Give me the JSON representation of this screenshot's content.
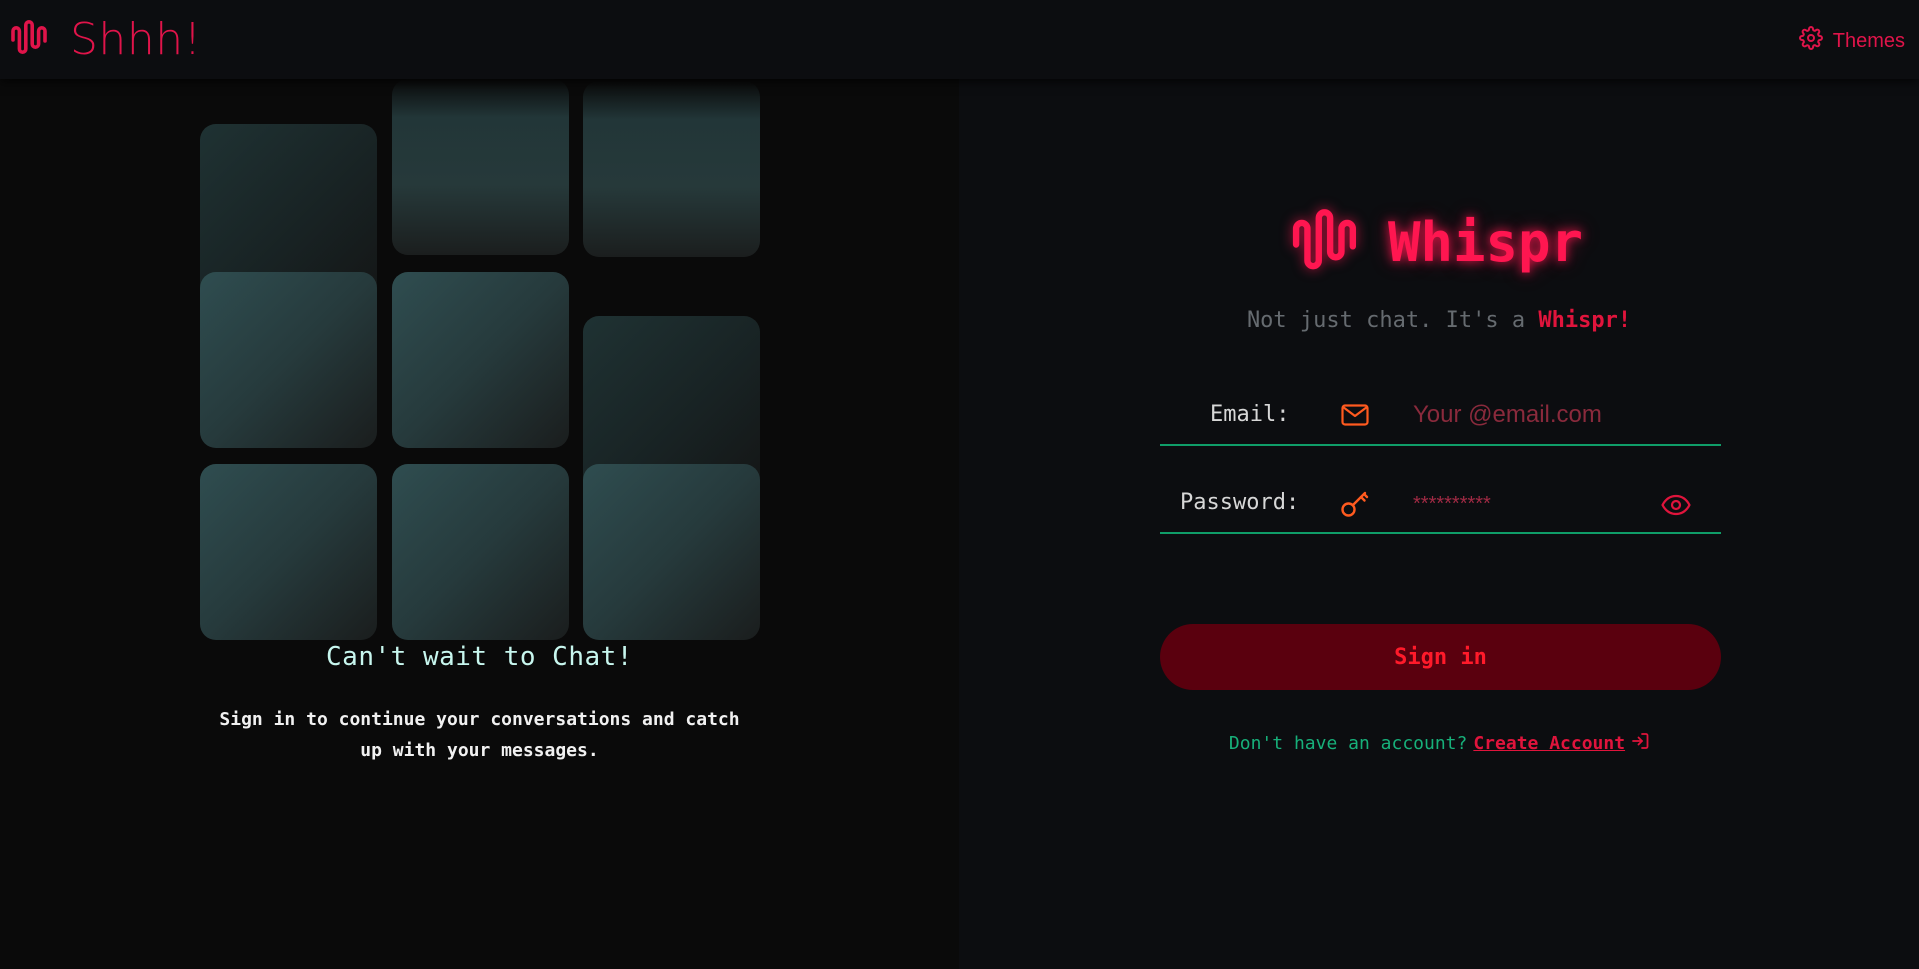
{
  "navbar": {
    "brand": "Shhh!",
    "themes_label": "Themes",
    "icons": {
      "logo": "sound-wave-icon",
      "themes": "gear-icon"
    }
  },
  "left": {
    "heading": "Can't wait to Chat!",
    "description": "Sign in to continue your conversations and catch up with your messages."
  },
  "auth": {
    "brand": "Whispr",
    "tagline_prefix": "Not just chat. It's a ",
    "tagline_accent": "Whispr!",
    "email": {
      "label": "Email:",
      "placeholder": "Your @email.com",
      "value": "",
      "icon": "mail-icon"
    },
    "password": {
      "label": "Password:",
      "placeholder": "**********",
      "value": "",
      "icon": "key-icon",
      "toggle_icon": "eye-icon"
    },
    "signin_label": "Sign in",
    "signup_prompt": "Don't have an account?",
    "signup_link": "Create Account",
    "signup_icon": "sign-in-arrow-icon"
  },
  "colors": {
    "accent": "#e0144a",
    "brand_glow": "#ff1650",
    "field_underline": "#0f9d68",
    "button_bg": "#5a000e",
    "button_text": "#ff1a2a",
    "link_green": "#17b07a",
    "icon_orange": "#ff5a1f"
  }
}
